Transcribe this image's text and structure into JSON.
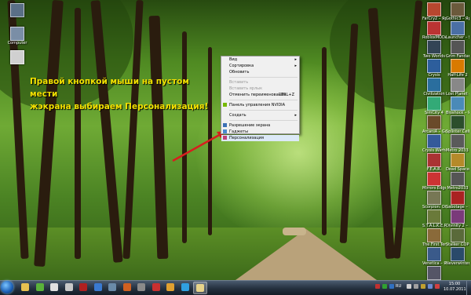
{
  "caption": {
    "line1": "Правой кнопкой мыши на пустом мести",
    "line2": "жэкрана выбираем Персонализация!"
  },
  "context_menu": {
    "items": [
      {
        "label": "Вид",
        "submenu": true,
        "disabled": false
      },
      {
        "label": "Сортировка",
        "submenu": true,
        "disabled": false
      },
      {
        "label": "Обновить",
        "submenu": false,
        "disabled": false
      },
      {
        "label": "Вставить",
        "submenu": false,
        "disabled": true
      },
      {
        "label": "Вставить ярлык",
        "submenu": false,
        "disabled": true
      },
      {
        "label": "Отменить переименование",
        "shortcut": "CTRL+Z",
        "submenu": false,
        "disabled": false
      },
      {
        "label": "Панель управления NVIDIA",
        "submenu": false,
        "disabled": false
      },
      {
        "label": "Создать",
        "submenu": true,
        "disabled": false
      },
      {
        "label": "Разрешение экрана",
        "submenu": false,
        "disabled": false
      },
      {
        "label": "Гаджеты",
        "submenu": false,
        "disabled": false
      },
      {
        "label": "Персонализация",
        "submenu": false,
        "disabled": false
      }
    ]
  },
  "desktop_icons_left": [
    {
      "label": "",
      "color": "#5a6f86"
    },
    {
      "label": "Computer",
      "color": "#7a8ea6"
    },
    {
      "label": "",
      "color": "#d0d0d0"
    }
  ],
  "desktop_icons_right": [
    {
      "label": "FarCry2 – Ярлык",
      "color": "#b8472f"
    },
    {
      "label": "Gothic3 – Ярлык",
      "color": "#6b5a3c"
    },
    {
      "label": "RobloxMODA",
      "color": "#b33"
    },
    {
      "label": "Launcher – Ярлык",
      "color": "#4a6fa5"
    },
    {
      "label": "Two Worlds",
      "color": "#345"
    },
    {
      "label": "Grim Fandango",
      "color": "#555"
    },
    {
      "label": "Crysis",
      "color": "#2d5e9c"
    },
    {
      "label": "Half-Life 2",
      "color": "#d97a00"
    },
    {
      "label": "Civilization",
      "color": "#2a6e9e"
    },
    {
      "label": "Lost Planet – Ярлык",
      "color": "#888"
    },
    {
      "label": "SimCity 4",
      "color": "#3a7"
    },
    {
      "label": "Bioshock – Ярлык",
      "color": "#4a8ab8"
    },
    {
      "label": "ArcaniA – Gothic 4 – Ярлык",
      "color": "#6a4a2a"
    },
    {
      "label": "Splinter Cell",
      "color": "#2c4e2c"
    },
    {
      "label": "Crysis Warhead",
      "color": "#345a9a"
    },
    {
      "label": "Metro 2033 – Ярлык",
      "color": "#5a5a5a"
    },
    {
      "label": "F.E.A.R.",
      "color": "#a33"
    },
    {
      "label": "Dead Space",
      "color": "#b58a2a"
    },
    {
      "label": "Mirrors Edge",
      "color": "#c33"
    },
    {
      "label": "Metro2033",
      "color": "#555"
    },
    {
      "label": "Scorpion: Disfigured",
      "color": "#775"
    },
    {
      "label": "Sabotage – Ярлык",
      "color": "#a22"
    },
    {
      "label": "S.T.A.L.K.E.R.",
      "color": "#6a7a3a"
    },
    {
      "label": "Divinity 2 – Ярлык",
      "color": "#7a3a7a"
    },
    {
      "label": "The First Templar",
      "color": "#8a6a3a"
    },
    {
      "label": "Stalker COP – Ярлык",
      "color": "#5a6a3a"
    },
    {
      "label": "Venetica – Ярлык",
      "color": "#3a5a8a"
    },
    {
      "label": "Neverwinter – Ярлык",
      "color": "#2a4a6a"
    },
    {
      "label": "CK – Dragon Rising",
      "color": "#556"
    }
  ],
  "taskbar": {
    "pinned": [
      {
        "name": "explorer",
        "color": "#e8c050"
      },
      {
        "name": "utorrent",
        "color": "#5ab23a"
      },
      {
        "name": "media",
        "color": "#e0e0e0"
      },
      {
        "name": "chrome",
        "color": "#c8c8c8"
      },
      {
        "name": "game",
        "color": "#b02020"
      },
      {
        "name": "sound",
        "color": "#3a7ad0"
      },
      {
        "name": "app7",
        "color": "#6a8aa8"
      },
      {
        "name": "app8",
        "color": "#d06020"
      },
      {
        "name": "app9",
        "color": "#8a8a8a"
      },
      {
        "name": "app10",
        "color": "#c83030"
      },
      {
        "name": "app11",
        "color": "#e0a030"
      },
      {
        "name": "app12",
        "color": "#30a0e0"
      },
      {
        "name": "folder",
        "color": "#e8d48a"
      }
    ],
    "language": "RU",
    "clock_time": "15:00",
    "clock_date": "10.07.2011"
  },
  "colors": {
    "caption_text": "#f3e100",
    "arrow": "#d81e1e",
    "menu_bg": "#f0f0f0"
  }
}
